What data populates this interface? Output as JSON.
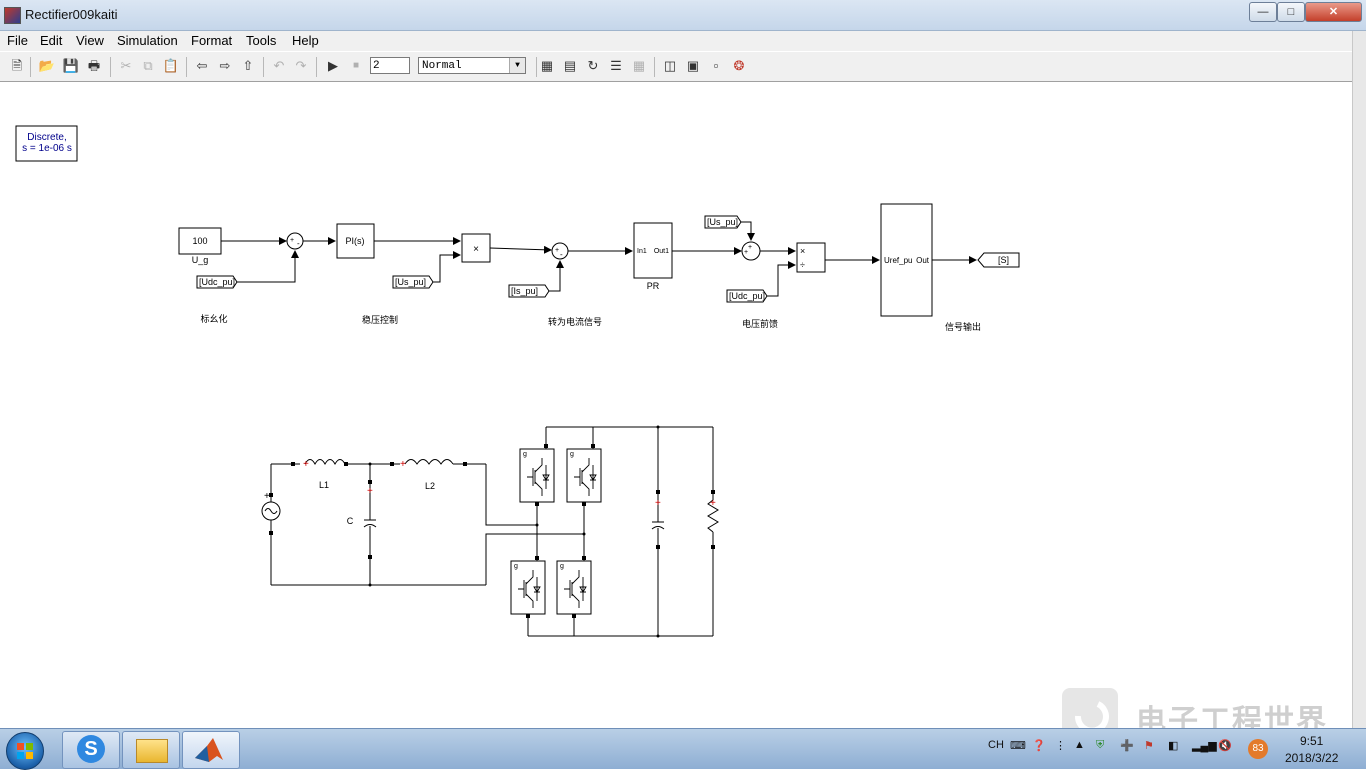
{
  "window": {
    "title": "Rectifier009kaiti"
  },
  "menu": [
    "File",
    "Edit",
    "View",
    "Simulation",
    "Format",
    "Tools",
    "Help"
  ],
  "toolbar": {
    "stop_time": "2",
    "sim_mode": "Normal"
  },
  "diagram": {
    "powergui": [
      "Discrete,",
      "s = 1e-06 s"
    ],
    "const_value": "100",
    "const_label": "U_g",
    "pi_block": "PI(s)",
    "mult": "×",
    "pr_in": "In1",
    "pr_out": "Out1",
    "pr_label": "PR",
    "uref_in": "Uref_pu",
    "uref_out": "Out",
    "tag_udc1": "[Udc_pu]",
    "tag_us1": "[Us_pu]",
    "tag_is": "[Is_pu]",
    "tag_us2": "[Us_pu]",
    "tag_udc2": "[Udc_pu]",
    "tag_s": "[S]",
    "cap_norm": "标幺化",
    "cap_volt_ctrl": "稳压控制",
    "cap_current": "转为电流信号",
    "cap_ff": "电压前馈",
    "cap_out": "信号输出",
    "l1": "L1",
    "l2": "L2",
    "c": "C",
    "g": "g",
    "plus": "+",
    "minus": "-",
    "times": "×",
    "div": "÷"
  },
  "tray": {
    "lang": "CH",
    "badge": "83",
    "time": "9:51",
    "date": "2018/3/22"
  },
  "watermark": "电子工程世界"
}
